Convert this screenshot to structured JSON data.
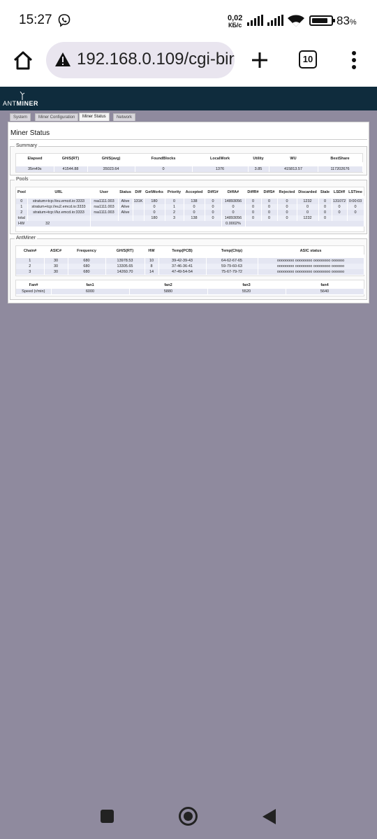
{
  "status_bar": {
    "time": "15:27",
    "net_speed_value": "0,02",
    "net_speed_unit": "КБ/с",
    "battery_percent": "83",
    "battery_percent_sign": "%",
    "battery_level": 0.83
  },
  "browser": {
    "url": "192.168.0.109/cgi-bin",
    "tab_count": "10"
  },
  "miner_page": {
    "logo_ant": "ANT",
    "logo_miner": "MINER",
    "tabs": [
      "System",
      "Miner Configuration",
      "Miner Status",
      "Network"
    ],
    "title": "Miner Status",
    "summary": {
      "legend": "Summary",
      "headers": [
        "Elapsed",
        "GH/S(RT)",
        "GH/S(avg)",
        "FoundBlocks",
        "LocalWork",
        "Utility",
        "WU",
        "BestShare"
      ],
      "row": [
        "35m49s",
        "41544.88",
        "35023.64",
        "0",
        "1376",
        "3.85",
        "415813.57",
        "117202676"
      ]
    },
    "pools": {
      "legend": "Pools",
      "headers": [
        "Pool",
        "URL",
        "User",
        "Status",
        "Diff",
        "GetWorks",
        "Priority",
        "Accepted",
        "Diff1#",
        "DiffA#",
        "DiffR#",
        "DiffS#",
        "Rejected",
        "Discarded",
        "Stale",
        "LSDiff",
        "LSTime"
      ],
      "rows": [
        [
          "0",
          "stratum+tcp://eu.emcd.io:3333",
          "rsa1111.003",
          "Alive",
          "131K",
          "180",
          "0",
          "138",
          "0",
          "14893056",
          "0",
          "0",
          "0",
          "1232",
          "0",
          "131072",
          "0:00:03"
        ],
        [
          "1",
          "stratum+tcp://eu2.emcd.io:3333",
          "rsa1111.003",
          "Alive",
          "",
          "0",
          "1",
          "0",
          "0",
          "0",
          "0",
          "0",
          "0",
          "0",
          "0",
          "0",
          "0"
        ],
        [
          "2",
          "stratum+tcp://kz.emcd.io:3333",
          "rsa1111.003",
          "Alive",
          "",
          "0",
          "2",
          "0",
          "0",
          "0",
          "0",
          "0",
          "0",
          "0",
          "0",
          "0",
          "0"
        ],
        [
          "total",
          "",
          "",
          "",
          "",
          "180",
          "3",
          "138",
          "0",
          "14893056",
          "0",
          "0",
          "0",
          "1232",
          "0",
          "",
          ""
        ]
      ],
      "hw_label": "HW",
      "hw_value": "32",
      "hw_percent": "0.0002%"
    },
    "antminer": {
      "legend": "AntMiner",
      "chain_headers": [
        "Chain#",
        "ASIC#",
        "Frequency",
        "GH/S(RT)",
        "HW",
        "Temp(PCB)",
        "Temp(Chip)",
        "ASIC status"
      ],
      "chain_rows": [
        [
          "1",
          "30",
          "680",
          "13978.53",
          "10",
          "39-42-39-43",
          "64-62-67-65",
          "oooooooo oooooooo oooooooo oooooo"
        ],
        [
          "2",
          "30",
          "680",
          "13305.65",
          "8",
          "37-46-36-41",
          "59-79-60-63",
          "oooooooo oooooooo oooooooo oooooo"
        ],
        [
          "3",
          "30",
          "680",
          "14260.70",
          "14",
          "47-49-54-54",
          "75-67-79-72",
          "oooooooo oooooooo oooooooo oooooo"
        ]
      ],
      "fan_headers": [
        "Fan#",
        "fan1",
        "fan2",
        "fan3",
        "fan4"
      ],
      "fan_row": [
        "Speed (r/min)",
        "6000",
        "5880",
        "5520",
        "5640"
      ]
    }
  }
}
